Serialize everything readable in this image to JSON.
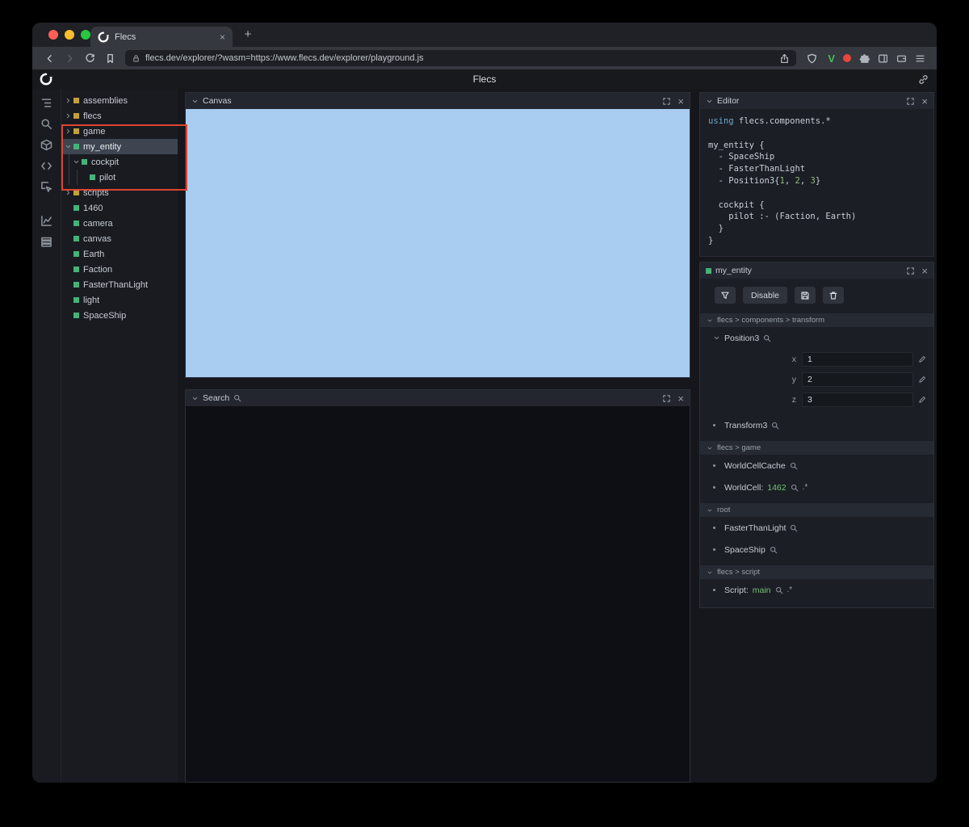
{
  "browser": {
    "tab_title": "Flecs",
    "url": "flecs.dev/explorer/?wasm=https://www.flecs.dev/explorer/playground.js",
    "new_tab": "+"
  },
  "app": {
    "title": "Flecs"
  },
  "colors": {
    "entity_green": "#45b277",
    "module_yellow": "#c2a136",
    "canvas_blue": "#a9cdf0",
    "annotation_red": "#dd4530"
  },
  "icon_strip": [
    "outline-icon",
    "search-icon",
    "entities-icon",
    "code-icon",
    "inspect-icon",
    "stats-icon",
    "table-icon"
  ],
  "tree": {
    "items": [
      {
        "label": "assemblies",
        "type": "module",
        "chevron": "right",
        "level": 0,
        "selected": false
      },
      {
        "label": "flecs",
        "type": "module",
        "chevron": "right",
        "level": 0,
        "selected": false
      },
      {
        "label": "game",
        "type": "module",
        "chevron": "right",
        "level": 0,
        "selected": false
      },
      {
        "label": "my_entity",
        "type": "entity",
        "chevron": "down",
        "level": 0,
        "selected": true
      },
      {
        "label": "cockpit",
        "type": "entity",
        "chevron": "down",
        "level": 1,
        "selected": false
      },
      {
        "label": "pilot",
        "type": "entity",
        "chevron": "none",
        "level": 2,
        "selected": false
      },
      {
        "label": "scripts",
        "type": "module",
        "chevron": "right",
        "level": 0,
        "selected": false
      },
      {
        "label": "1460",
        "type": "entity",
        "chevron": "none",
        "level": 0,
        "selected": false
      },
      {
        "label": "camera",
        "type": "entity",
        "chevron": "none",
        "level": 0,
        "selected": false
      },
      {
        "label": "canvas",
        "type": "entity",
        "chevron": "none",
        "level": 0,
        "selected": false
      },
      {
        "label": "Earth",
        "type": "entity",
        "chevron": "none",
        "level": 0,
        "selected": false
      },
      {
        "label": "Faction",
        "type": "entity",
        "chevron": "none",
        "level": 0,
        "selected": false
      },
      {
        "label": "FasterThanLight",
        "type": "entity",
        "chevron": "none",
        "level": 0,
        "selected": false
      },
      {
        "label": "light",
        "type": "entity",
        "chevron": "none",
        "level": 0,
        "selected": false
      },
      {
        "label": "SpaceShip",
        "type": "entity",
        "chevron": "none",
        "level": 0,
        "selected": false
      }
    ]
  },
  "canvas_panel": {
    "title": "Canvas"
  },
  "search_panel": {
    "title": "Search"
  },
  "editor_panel": {
    "title": "Editor",
    "code": [
      [
        {
          "c": "k",
          "t": "using"
        },
        {
          "c": "p",
          "t": " flecs.components.*"
        }
      ],
      [],
      [
        {
          "c": "p",
          "t": "my_entity {"
        }
      ],
      [
        {
          "c": "p",
          "t": "  - SpaceShip"
        }
      ],
      [
        {
          "c": "p",
          "t": "  - FasterThanLight"
        }
      ],
      [
        {
          "c": "p",
          "t": "  - Position3{"
        },
        {
          "c": "n",
          "t": "1"
        },
        {
          "c": "p",
          "t": ", "
        },
        {
          "c": "n",
          "t": "2"
        },
        {
          "c": "p",
          "t": ", "
        },
        {
          "c": "n",
          "t": "3"
        },
        {
          "c": "p",
          "t": "}"
        }
      ],
      [],
      [
        {
          "c": "p",
          "t": "  cockpit {"
        }
      ],
      [
        {
          "c": "p",
          "t": "    pilot :- (Faction, Earth)"
        }
      ],
      [
        {
          "c": "p",
          "t": "  }"
        }
      ],
      [
        {
          "c": "p",
          "t": "}"
        }
      ]
    ]
  },
  "inspector": {
    "title": "my_entity",
    "toolbar": {
      "disable_label": "Disable"
    },
    "sections": [
      {
        "path": "flecs > components > transform",
        "rows": [
          {
            "kind": "expanded",
            "name": "Position3",
            "fields": [
              {
                "label": "x",
                "value": "1"
              },
              {
                "label": "y",
                "value": "2"
              },
              {
                "label": "z",
                "value": "3"
              }
            ]
          },
          {
            "kind": "item",
            "name": "Transform3"
          }
        ]
      },
      {
        "path": "flecs > game",
        "rows": [
          {
            "kind": "item",
            "name": "WorldCellCache"
          },
          {
            "kind": "item",
            "name": "WorldCell:",
            "value": "1462",
            "suffix": ".*"
          }
        ]
      },
      {
        "path": "root",
        "rows": [
          {
            "kind": "item",
            "name": "FasterThanLight"
          },
          {
            "kind": "item",
            "name": "SpaceShip"
          }
        ]
      },
      {
        "path": "flecs > script",
        "rows": [
          {
            "kind": "item",
            "name": "Script:",
            "value": "main",
            "suffix": ".*"
          }
        ]
      }
    ]
  }
}
